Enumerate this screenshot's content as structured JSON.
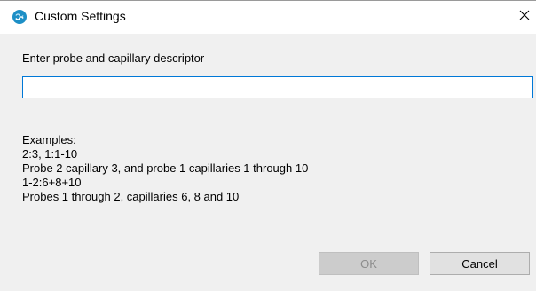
{
  "window": {
    "title": "Custom Settings",
    "icon": "sw-logo-icon",
    "close_glyph": "✕"
  },
  "form": {
    "prompt_label": "Enter probe and capillary descriptor",
    "descriptor_value": "",
    "descriptor_placeholder": ""
  },
  "examples": {
    "heading": "Examples:",
    "lines": [
      "2:3, 1:1-10",
      "Probe 2 capillary 3, and probe 1 capillaries 1 through 10",
      "1-2:6+8+10",
      "Probes 1 through 2, capillaries 6, 8 and 10"
    ]
  },
  "buttons": {
    "ok_label": "OK",
    "ok_enabled": false,
    "cancel_label": "Cancel"
  },
  "colors": {
    "accent": "#0078d7",
    "icon_bg": "#1d8fc6"
  }
}
